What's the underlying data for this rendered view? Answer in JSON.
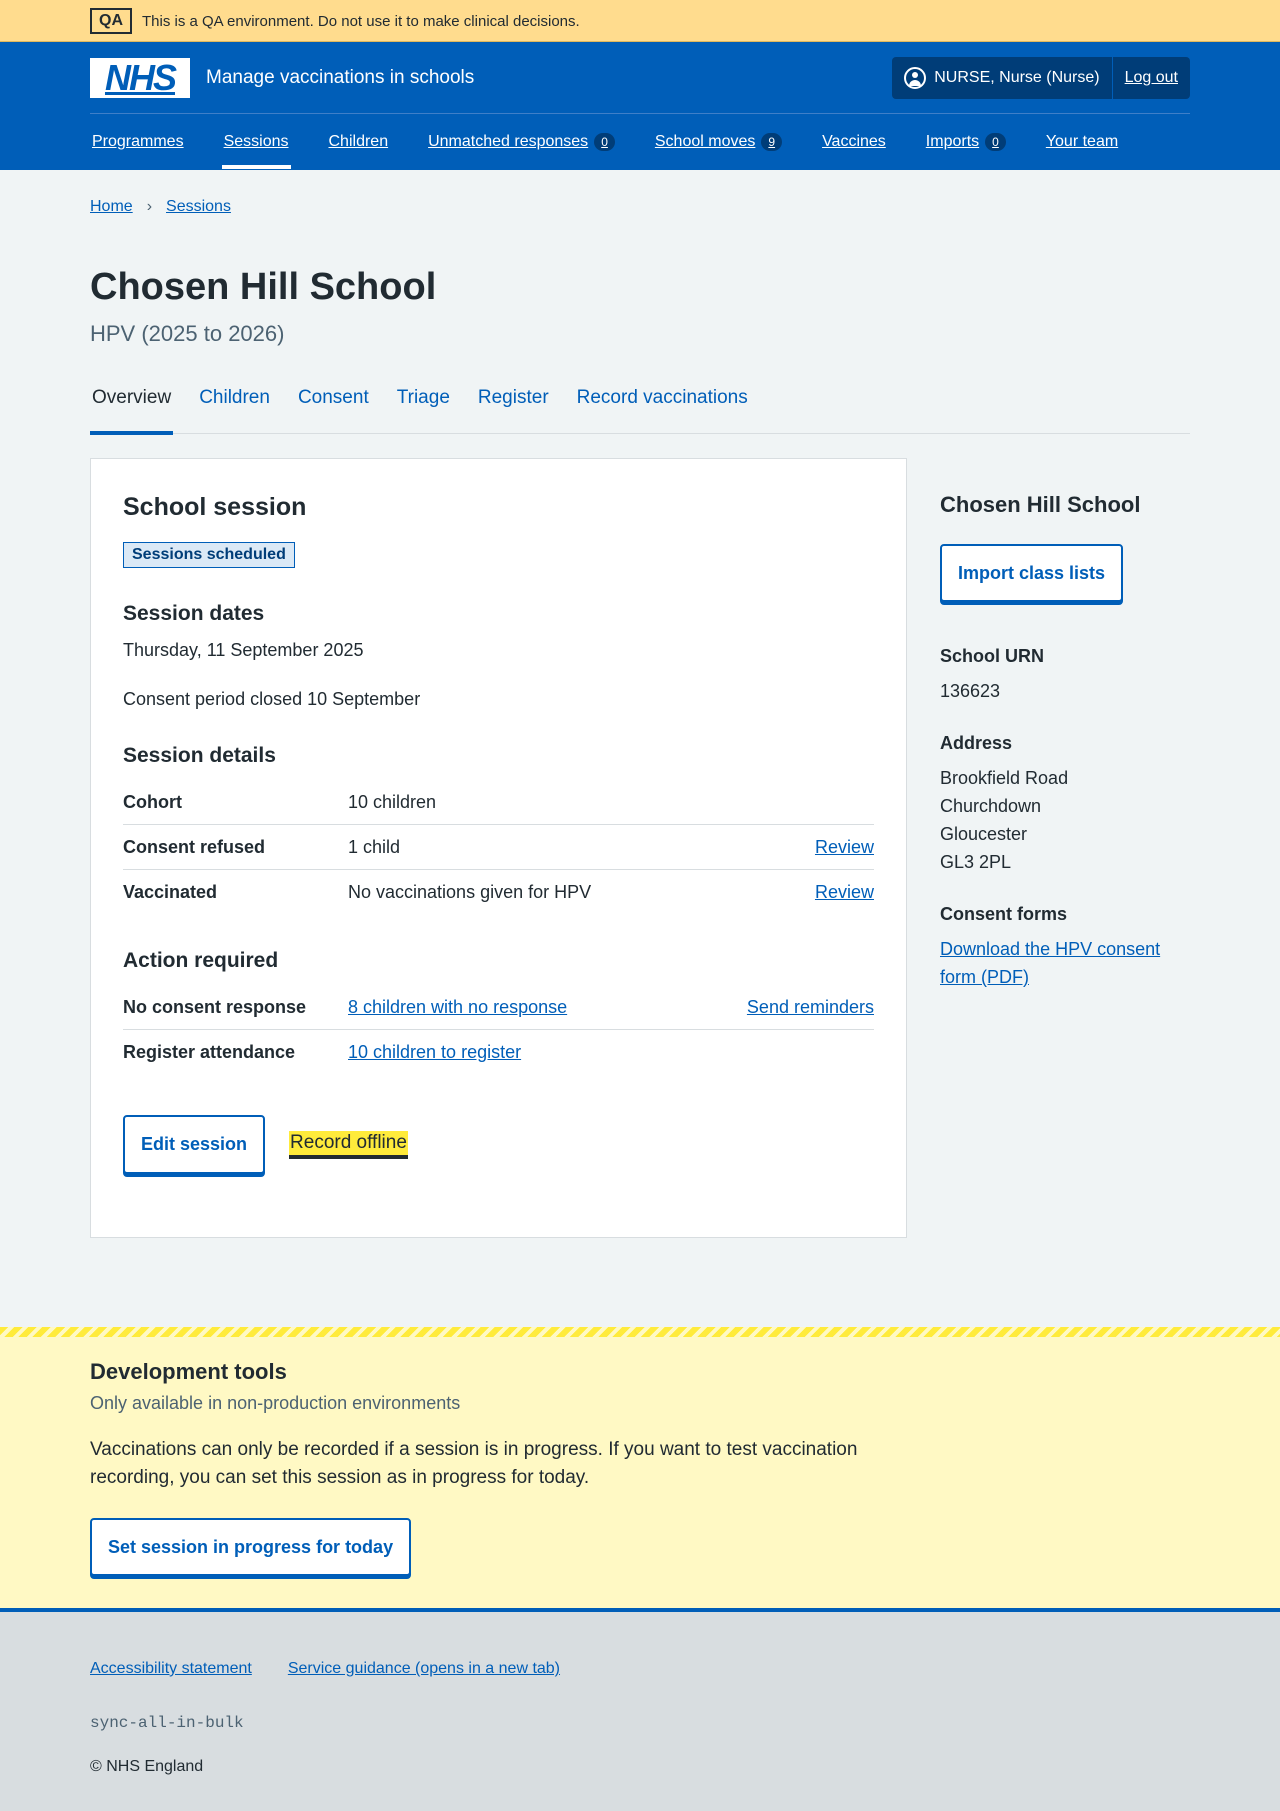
{
  "qa_banner": {
    "tag": "QA",
    "text": "This is a QA environment. Do not use it to make clinical decisions."
  },
  "header": {
    "logo": "NHS",
    "service_name": "Manage vaccinations in schools",
    "user": "NURSE, Nurse (Nurse)",
    "logout": "Log out",
    "nav": [
      {
        "label": "Programmes"
      },
      {
        "label": "Sessions"
      },
      {
        "label": "Children"
      },
      {
        "label": "Unmatched responses",
        "badge": "0"
      },
      {
        "label": "School moves",
        "badge": "9"
      },
      {
        "label": "Vaccines"
      },
      {
        "label": "Imports",
        "badge": "0"
      },
      {
        "label": "Your team"
      }
    ]
  },
  "breadcrumb": [
    "Home",
    "Sessions"
  ],
  "page": {
    "title": "Chosen Hill School",
    "caption": "HPV (2025 to 2026)"
  },
  "tabs": [
    "Overview",
    "Children",
    "Consent",
    "Triage",
    "Register",
    "Record vaccinations"
  ],
  "session": {
    "heading": "School session",
    "status": "Sessions scheduled",
    "dates_heading": "Session dates",
    "date": "Thursday, 11 September 2025",
    "consent_period": "Consent period closed 10 September",
    "details_heading": "Session details",
    "details": [
      {
        "key": "Cohort",
        "value": "10 children",
        "action": ""
      },
      {
        "key": "Consent refused",
        "value": "1 child",
        "action": "Review"
      },
      {
        "key": "Vaccinated",
        "value": "No vaccinations given for HPV",
        "action": "Review"
      }
    ],
    "action_heading": "Action required",
    "actions": [
      {
        "key": "No consent response",
        "value": "8 children with no response",
        "action": "Send reminders"
      },
      {
        "key": "Register attendance",
        "value": "10 children to register",
        "action": ""
      }
    ],
    "edit_button": "Edit session",
    "offline_link": "Record offline"
  },
  "sidebar": {
    "title": "Chosen Hill School",
    "import_button": "Import class lists",
    "urn_label": "School URN",
    "urn": "136623",
    "address_label": "Address",
    "address": [
      "Brookfield Road",
      "Churchdown",
      "Gloucester",
      "GL3 2PL"
    ],
    "consent_label": "Consent forms",
    "consent_link": "Download the HPV consent form (PDF)"
  },
  "dev_tools": {
    "heading": "Development tools",
    "subheading": "Only available in non-production environments",
    "text": "Vaccinations can only be recorded if a session is in progress. If you want to test vaccination recording, you can set this session as in progress for today.",
    "button": "Set session in progress for today"
  },
  "footer": {
    "links": [
      "Accessibility statement",
      "Service guidance (opens in a new tab)"
    ],
    "build": "sync-all-in-bulk",
    "copyright": "© NHS England"
  },
  "colors": {
    "nhs_blue": "#005eb8",
    "qa_banner": "#ffdc8e",
    "dev_tools_bg": "#fff9c4",
    "highlight": "#ffeb3b"
  }
}
